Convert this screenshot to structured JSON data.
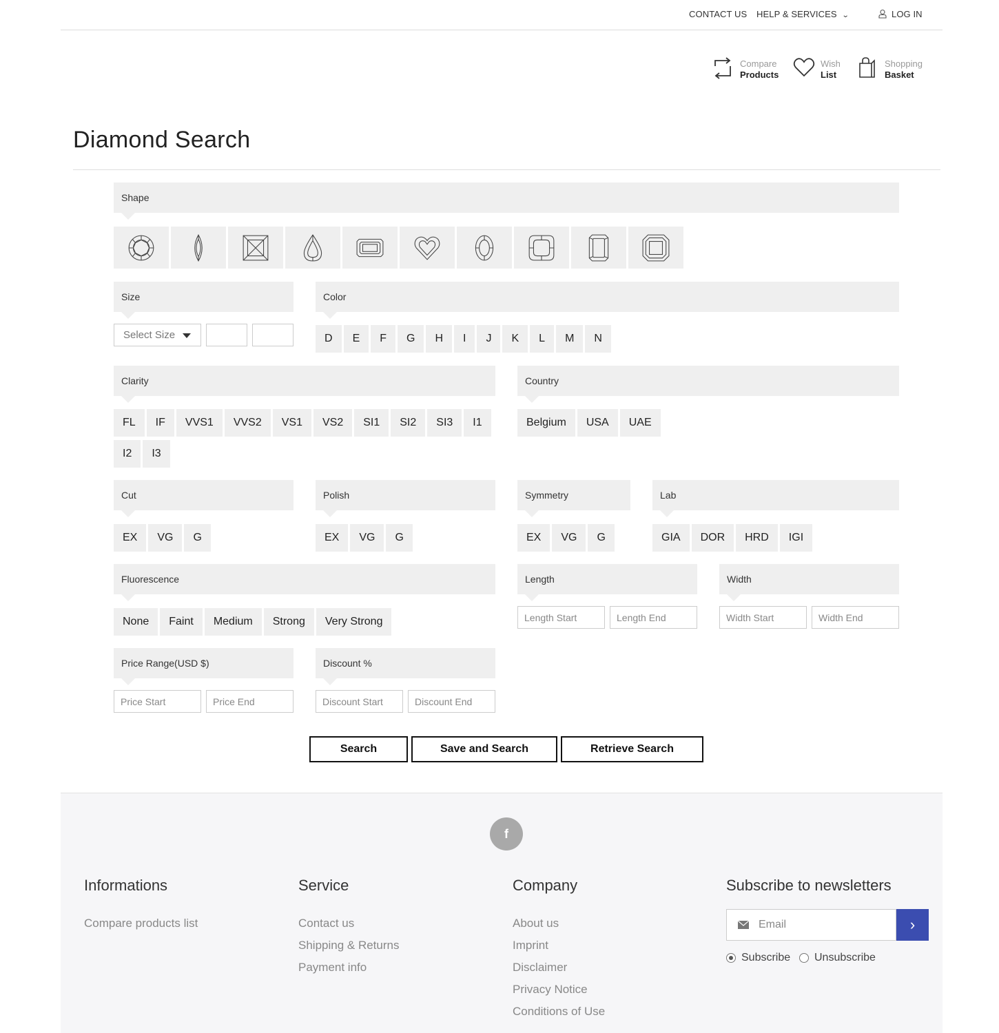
{
  "topbar": {
    "contact": "CONTACT US",
    "help": "HELP & SERVICES",
    "login": "LOG IN"
  },
  "header": {
    "compare": {
      "line1": "Compare",
      "line2": "Products"
    },
    "wish": {
      "line1": "Wish",
      "line2": "List"
    },
    "basket": {
      "line1": "Shopping",
      "line2": "Basket"
    }
  },
  "page_title": "Diamond Search",
  "sections": {
    "shape": "Shape",
    "size": "Size",
    "color": "Color",
    "clarity": "Clarity",
    "country": "Country",
    "cut": "Cut",
    "polish": "Polish",
    "symmetry": "Symmetry",
    "lab": "Lab",
    "fluorescence": "Fluorescence",
    "length": "Length",
    "width": "Width",
    "price": "Price Range(USD $)",
    "discount": "Discount %"
  },
  "shapes": [
    "round-shape-icon",
    "marquise-shape-icon",
    "princess-shape-icon",
    "pear-shape-icon",
    "emerald-shape-icon",
    "heart-shape-icon",
    "oval-shape-icon",
    "cushion-shape-icon",
    "radiant-shape-icon",
    "asscher-shape-icon"
  ],
  "size_select": "Select Size",
  "colors": [
    "D",
    "E",
    "F",
    "G",
    "H",
    "I",
    "J",
    "K",
    "L",
    "M",
    "N"
  ],
  "clarity": [
    "FL",
    "IF",
    "VVS1",
    "VVS2",
    "VS1",
    "VS2",
    "SI1",
    "SI2",
    "SI3",
    "I1",
    "I2",
    "I3"
  ],
  "countries": [
    "Belgium",
    "USA",
    "UAE"
  ],
  "cut": [
    "EX",
    "VG",
    "G"
  ],
  "polish": [
    "EX",
    "VG",
    "G"
  ],
  "symmetry": [
    "EX",
    "VG",
    "G"
  ],
  "labs": [
    "GIA",
    "DOR",
    "HRD",
    "IGI"
  ],
  "fluorescence": [
    "None",
    "Faint",
    "Medium",
    "Strong",
    "Very Strong"
  ],
  "placeholders": {
    "length_start": "Length Start",
    "length_end": "Length End",
    "width_start": "Width Start",
    "width_end": "Width End",
    "price_start": "Price Start",
    "price_end": "Price End",
    "discount_start": "Discount Start",
    "discount_end": "Discount End",
    "email": "Email"
  },
  "buttons": {
    "search": "Search",
    "save_search": "Save and Search",
    "retrieve": "Retrieve Search"
  },
  "footer": {
    "facebook": "f",
    "informations": {
      "title": "Informations",
      "links": [
        "Compare products list"
      ]
    },
    "service": {
      "title": "Service",
      "links": [
        "Contact us",
        "Shipping & Returns",
        "Payment info"
      ]
    },
    "company": {
      "title": "Company",
      "links": [
        "About us",
        "Imprint",
        "Disclaimer",
        "Privacy Notice",
        "Conditions of Use"
      ]
    },
    "newsletter": {
      "title": "Subscribe to newsletters",
      "subscribe": "Subscribe",
      "unsubscribe": "Unsubscribe",
      "submit": "›"
    }
  },
  "colors_theme": {
    "accent": "#3b4db0",
    "panel": "#efefef",
    "footer_bg": "#f6f6f8"
  }
}
